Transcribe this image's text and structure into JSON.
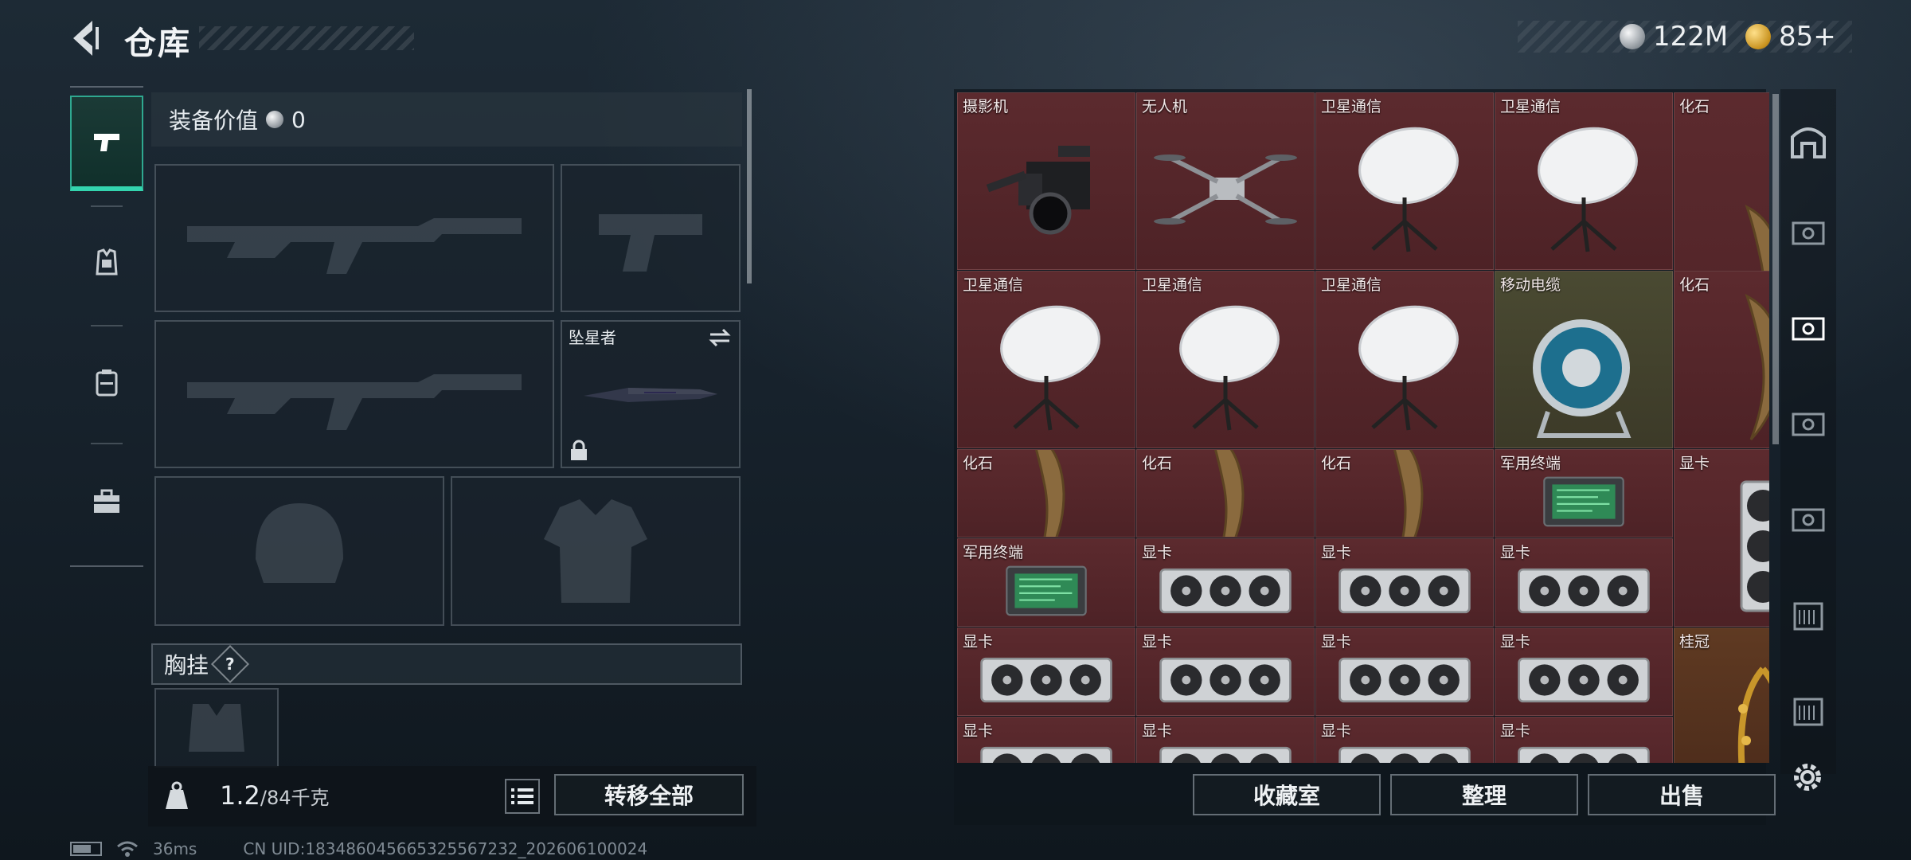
{
  "header": {
    "title": "仓库"
  },
  "currency": {
    "silver": "122M",
    "gold": "85+"
  },
  "equipment": {
    "value_label": "装备价值",
    "value": "0",
    "melee_slot_name": "坠星者",
    "chest_rig_label": "胸挂",
    "help_glyph": "?"
  },
  "weight": {
    "current": "1.2",
    "max": "/84千克"
  },
  "buttons": {
    "transfer_all": "转移全部",
    "collection": "收藏室",
    "sort": "整理",
    "sell": "出售"
  },
  "status": {
    "ping": "36ms",
    "uid": "CN UID:183486045665325567232_202606100024"
  },
  "storage": {
    "items": [
      {
        "name": "摄影机",
        "icon": "camera-icon"
      },
      {
        "name": "无人机",
        "icon": "drone-icon"
      },
      {
        "name": "卫星通信",
        "icon": "satellite-dish-icon"
      },
      {
        "name": "卫星通信",
        "icon": "satellite-dish-icon"
      },
      {
        "name": "化石",
        "icon": "fossil-claw-icon"
      },
      {
        "name": "卫星通信",
        "icon": "satellite-dish-icon"
      },
      {
        "name": "卫星通信",
        "icon": "satellite-dish-icon"
      },
      {
        "name": "卫星通信",
        "icon": "satellite-dish-icon"
      },
      {
        "name": "移动电缆",
        "icon": "cable-reel-icon"
      },
      {
        "name": "化石",
        "icon": "fossil-claw-icon"
      },
      {
        "name": "化石",
        "icon": "fossil-claw-icon"
      },
      {
        "name": "化石",
        "icon": "fossil-claw-icon"
      },
      {
        "name": "化石",
        "icon": "fossil-claw-icon"
      },
      {
        "name": "军用终端",
        "icon": "military-terminal-icon"
      },
      {
        "name": "显卡",
        "icon": "graphics-card-icon"
      },
      {
        "name": "军用终端",
        "icon": "military-terminal-icon"
      },
      {
        "name": "显卡",
        "icon": "graphics-card-icon"
      },
      {
        "name": "显卡",
        "icon": "graphics-card-icon"
      },
      {
        "name": "显卡",
        "icon": "graphics-card-icon"
      },
      {
        "name": "显卡",
        "icon": "graphics-card-icon"
      },
      {
        "name": "显卡",
        "icon": "graphics-card-icon"
      },
      {
        "name": "显卡",
        "icon": "graphics-card-icon"
      },
      {
        "name": "显卡",
        "icon": "graphics-card-icon"
      },
      {
        "name": "桂冠",
        "icon": "laurel-crown-icon"
      },
      {
        "name": "显卡",
        "icon": "graphics-card-icon"
      },
      {
        "name": "显卡",
        "icon": "graphics-card-icon"
      },
      {
        "name": "显卡",
        "icon": "graphics-card-icon"
      },
      {
        "name": "显卡",
        "icon": "graphics-card-icon"
      }
    ]
  }
}
